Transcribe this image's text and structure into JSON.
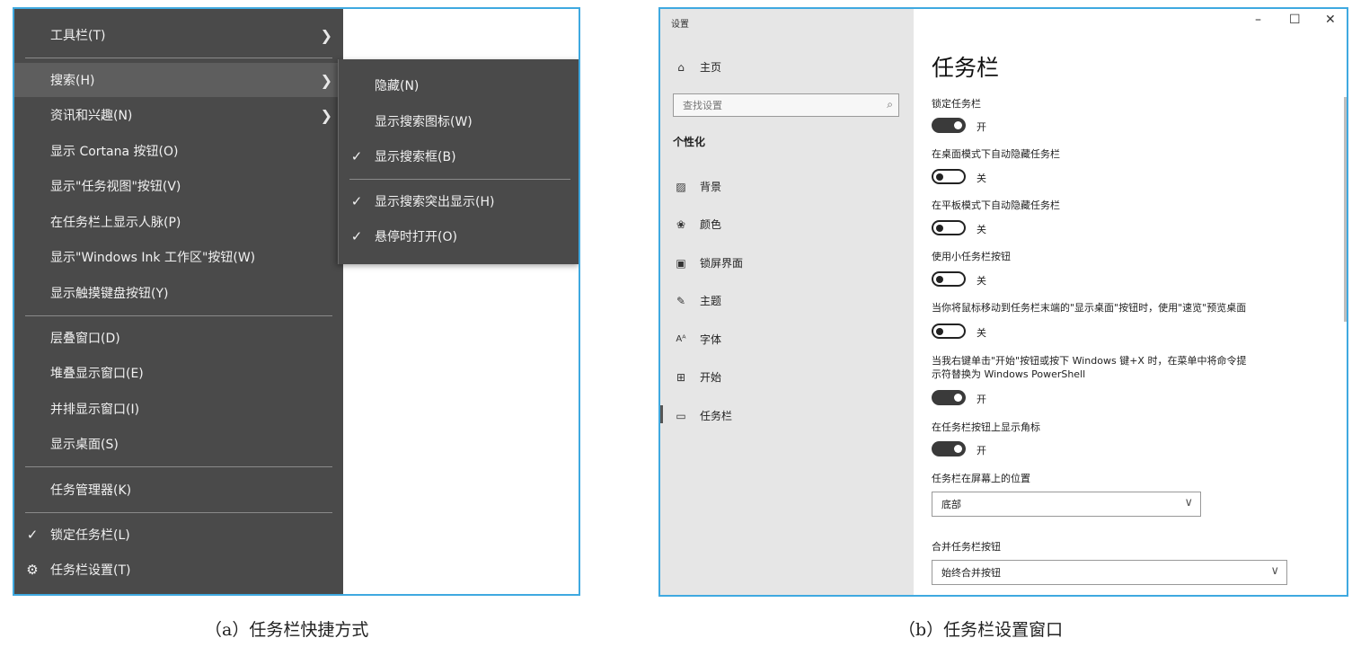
{
  "panel_a": {
    "menu": {
      "items": [
        {
          "label": "工具栏(T)",
          "submenu": true
        },
        {
          "label": "搜索(H)",
          "submenu": true,
          "active": true
        },
        {
          "label": "资讯和兴趣(N)",
          "submenu": true
        },
        {
          "label": "显示 Cortana 按钮(O)"
        },
        {
          "label": "显示\"任务视图\"按钮(V)"
        },
        {
          "label": "在任务栏上显示人脉(P)"
        },
        {
          "label": "显示\"Windows Ink 工作区\"按钮(W)"
        },
        {
          "label": "显示触摸键盘按钮(Y)"
        },
        {
          "label": "层叠窗口(D)"
        },
        {
          "label": "堆叠显示窗口(E)"
        },
        {
          "label": "并排显示窗口(I)"
        },
        {
          "label": "显示桌面(S)"
        },
        {
          "label": "任务管理器(K)"
        },
        {
          "label": "锁定任务栏(L)",
          "checked": true
        },
        {
          "label": "任务栏设置(T)",
          "icon": "gear-icon"
        }
      ]
    },
    "submenu": {
      "items": [
        {
          "label": "隐藏(N)"
        },
        {
          "label": "显示搜索图标(W)"
        },
        {
          "label": "显示搜索框(B)",
          "checked": true
        },
        {
          "label": "显示搜索突出显示(H)",
          "checked": true
        },
        {
          "label": "悬停时打开(O)",
          "checked": true
        }
      ]
    },
    "caption": "（a）任务栏快捷方式"
  },
  "panel_b": {
    "window_title": "设置",
    "window_controls": {
      "minimize": "–",
      "maximize": "☐",
      "close": "✕"
    },
    "sidebar": {
      "home": {
        "label": "主页",
        "icon": "home-icon"
      },
      "search_placeholder": "查找设置",
      "section": "个性化",
      "items": [
        {
          "label": "背景",
          "icon": "picture-icon"
        },
        {
          "label": "颜色",
          "icon": "palette-icon"
        },
        {
          "label": "锁屏界面",
          "icon": "lock-screen-icon"
        },
        {
          "label": "主题",
          "icon": "brush-icon"
        },
        {
          "label": "字体",
          "icon": "font-icon"
        },
        {
          "label": "开始",
          "icon": "start-icon"
        },
        {
          "label": "任务栏",
          "icon": "taskbar-icon",
          "active": true
        }
      ]
    },
    "main": {
      "title": "任务栏",
      "settings": [
        {
          "label": "锁定任务栏",
          "state": "开",
          "on": true
        },
        {
          "label": "在桌面模式下自动隐藏任务栏",
          "state": "关",
          "on": false
        },
        {
          "label": "在平板模式下自动隐藏任务栏",
          "state": "关",
          "on": false
        },
        {
          "label": "使用小任务栏按钮",
          "state": "关",
          "on": false
        },
        {
          "label": "当你将鼠标移动到任务栏末端的\"显示桌面\"按钮时，使用\"速览\"预览桌面",
          "state": "关",
          "on": false
        },
        {
          "label_line1": "当我右键单击\"开始\"按钮或按下 Windows 键+X 时，在菜单中将命令提",
          "label_line2": "示符替换为 Windows PowerShell",
          "state": "开",
          "on": true
        },
        {
          "label": "在任务栏按钮上显示角标",
          "state": "开",
          "on": true
        }
      ],
      "position": {
        "label": "任务栏在屏幕上的位置",
        "value": "底部"
      },
      "combine": {
        "label": "合并任务栏按钮",
        "value": "始终合并按钮"
      }
    },
    "caption": "（b）任务栏设置窗口"
  }
}
